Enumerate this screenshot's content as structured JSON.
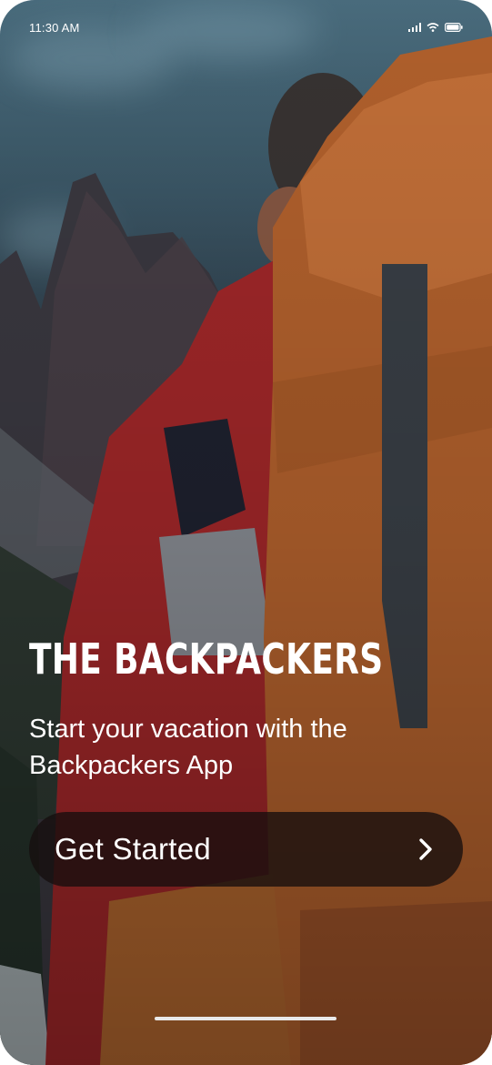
{
  "status_bar": {
    "time": "11:30 AM",
    "icons": [
      "cellular-signal-icon",
      "wifi-icon",
      "battery-icon"
    ]
  },
  "hero": {
    "title": "THE BACKPACKERS",
    "subtitle": "Start your vacation with the Backpackers App"
  },
  "cta": {
    "label": "Get Started",
    "icon": "chevron-right-icon"
  },
  "colors": {
    "text": "#ffffff",
    "cta_background": "#160e0e",
    "backpack_orange": "#b8642e",
    "jacket_red": "#a6282a"
  }
}
